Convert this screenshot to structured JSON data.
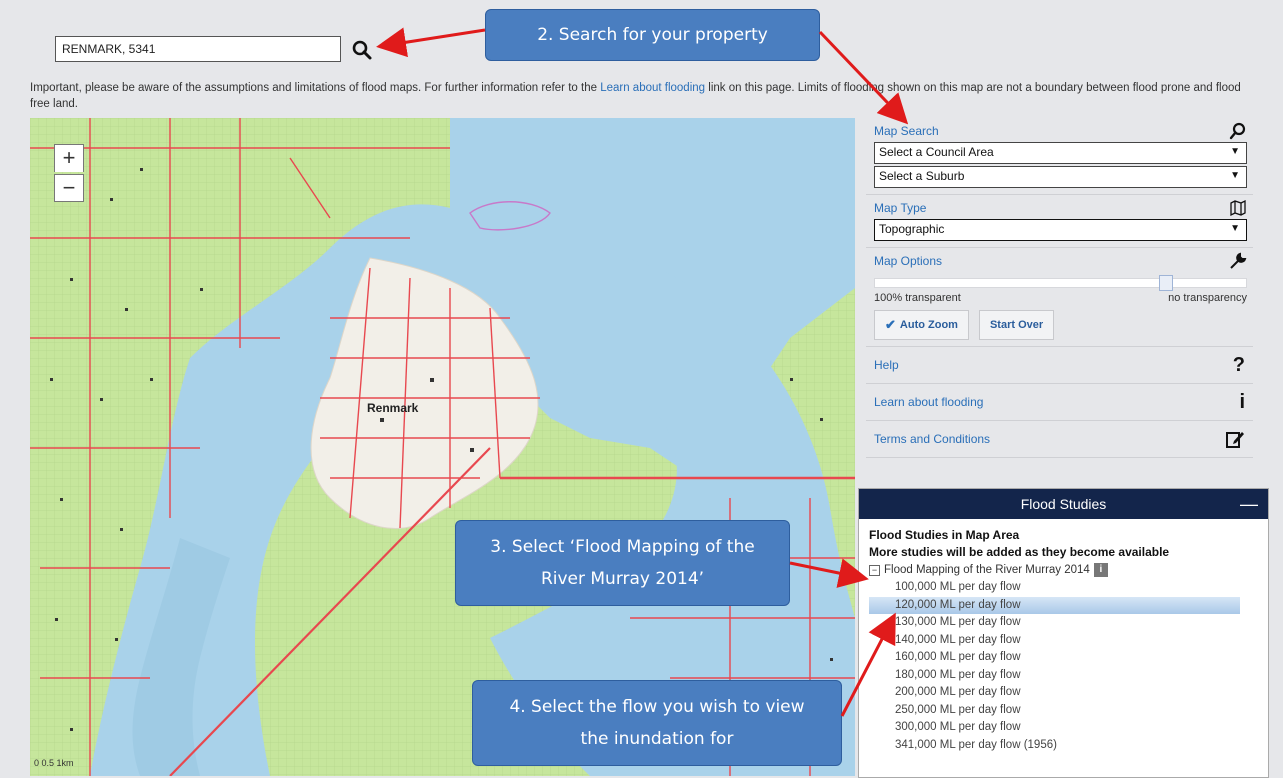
{
  "search": {
    "value": "RENMARK, 5341"
  },
  "disclaimer": {
    "before": "Important, please be aware of the assumptions and limitations of flood maps. For further information refer to the ",
    "link": "Learn about flooding",
    "after": " link on this page. Limits of flooding shown on this map are not a boundary between flood prone and flood free land."
  },
  "map": {
    "zoom_in": "+",
    "zoom_out": "−",
    "town_label": "Renmark",
    "scale_label": "0          0.5          1km"
  },
  "panel": {
    "map_search": {
      "title": "Map Search",
      "council": "Select a Council Area",
      "suburb": "Select a Suburb"
    },
    "map_type": {
      "title": "Map Type",
      "selected": "Topographic"
    },
    "map_options": {
      "title": "Map Options",
      "left_label": "100% transparent",
      "right_label": "no transparency",
      "slider_value": 0.79,
      "auto_zoom": "Auto Zoom",
      "start_over": "Start Over"
    },
    "help": "Help",
    "learn": "Learn about flooding",
    "terms": "Terms and Conditions"
  },
  "studies": {
    "header": "Flood Studies",
    "collapse": "—",
    "line1": "Flood Studies in Map Area",
    "line2": "More studies will be added as they become available",
    "root": "Flood Mapping of the River Murray 2014",
    "flows": [
      "100,000 ML per day flow",
      "120,000 ML per day flow",
      "130,000 ML per day flow",
      "140,000 ML per day flow",
      "160,000 ML per day flow",
      "180,000 ML per day flow",
      "200,000 ML per day flow",
      "250,000 ML per day flow",
      "300,000 ML per day flow",
      "341,000 ML per day flow (1956)"
    ],
    "selected_index": 1
  },
  "callouts": {
    "step2": "2. Search for your property",
    "step3": "3. Select ‘Flood Mapping of the River Murray 2014’",
    "step4": "4. Select the flow you wish to view the inundation for"
  },
  "colors": {
    "water": "#a9d2ea",
    "land": "#c6e69c",
    "road": "#e8484f",
    "callout": "#4a7ec0",
    "header": "#13254b",
    "link": "#2a6fb8",
    "arrow": "#e01b1b"
  }
}
